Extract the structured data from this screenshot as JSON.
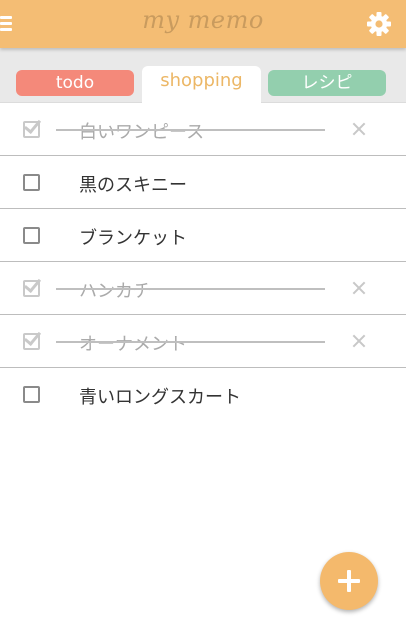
{
  "header": {
    "title": "my memo",
    "menu_icon": "hamburger-menu-icon",
    "settings_icon": "gear-icon",
    "background_color": "#f4bd74"
  },
  "tabs": [
    {
      "label": "todo",
      "color": "#f4897a",
      "selected": false
    },
    {
      "label": "shopping",
      "color": "#ecb766",
      "selected": true
    },
    {
      "label": "レシピ",
      "color": "#93cfae",
      "selected": false
    }
  ],
  "items": [
    {
      "label": "白いワンピース",
      "done": true
    },
    {
      "label": "黒のスキニー",
      "done": false
    },
    {
      "label": "ブランケット",
      "done": false
    },
    {
      "label": "ハンカチ",
      "done": true
    },
    {
      "label": "オーナメント",
      "done": true
    },
    {
      "label": "青いロングスカート",
      "done": false
    }
  ],
  "fab": {
    "icon": "plus-icon",
    "color": "#f4b96c"
  }
}
